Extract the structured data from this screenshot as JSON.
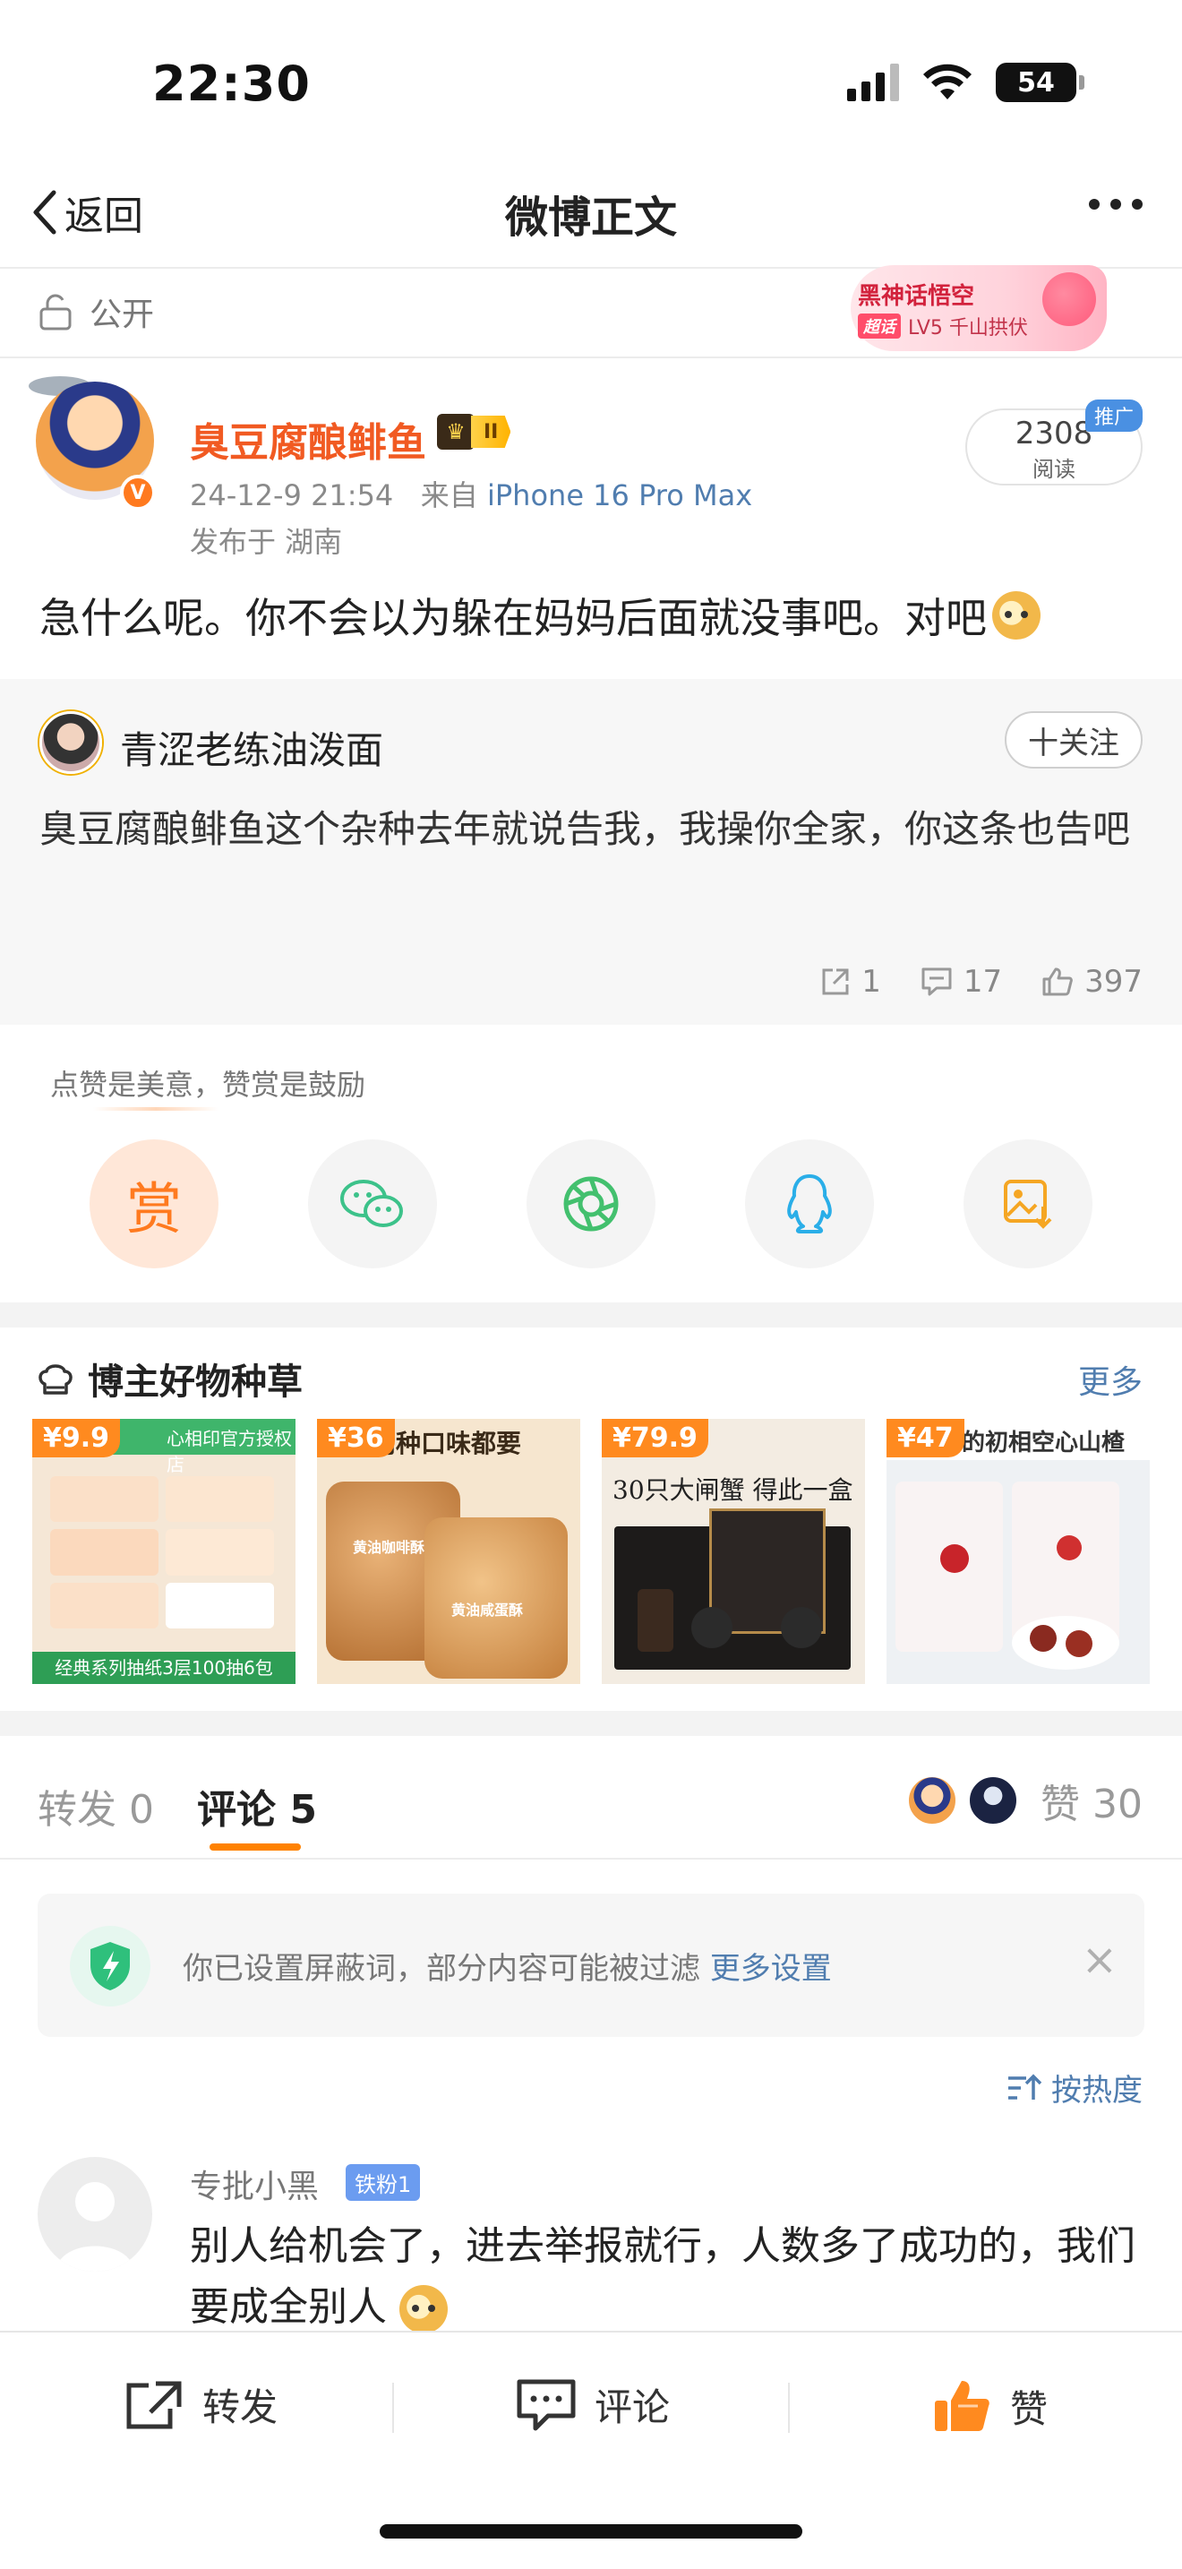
{
  "status_bar": {
    "time": "22:30",
    "battery": "54"
  },
  "nav": {
    "back_label": "返回",
    "title": "微博正文"
  },
  "visibility": {
    "label": "公开"
  },
  "promo_banner": {
    "line1": "黑神话悟空",
    "badge": "超话",
    "line2": "LV5 千山拱伏"
  },
  "author": {
    "name": "臭豆腐酿鲱鱼",
    "level_badge": "II",
    "date": "24-12-9 21:54",
    "source_prefix": "来自",
    "device": "iPhone 16 Pro Max",
    "location": "发布于 湖南",
    "verified_mark": "V"
  },
  "reads": {
    "count": "2308",
    "label": "阅读",
    "ad_tag": "推广"
  },
  "post": {
    "text": "急什么呢。你不会以为躲在妈妈后面就没事吧。对吧"
  },
  "retweet": {
    "name": "青涩老练油泼面",
    "follow_label": "十关注",
    "text": "臭豆腐酿鲱鱼这个杂种去年就说告我，我操你全家，你这条也告吧",
    "reposts": "1",
    "comments": "17",
    "likes": "397"
  },
  "tip": {
    "caption": "点赞是美意，赞赏是鼓励",
    "tip_button": "赏"
  },
  "goods": {
    "title": "博主好物种草",
    "more": "更多",
    "items": [
      {
        "price": "¥9.9",
        "caption": "经典系列抽纸3层100抽6包",
        "store": "心相印官方授权店"
      },
      {
        "price": "¥36",
        "caption": "两种口味都要",
        "tag1": "黄油咖啡酥",
        "tag2": "黄油咸蛋酥"
      },
      {
        "price": "¥79.9",
        "caption": "30只大闸蟹 得此一盒"
      },
      {
        "price": "¥47",
        "caption": "的初相空心山楂"
      }
    ]
  },
  "tabs": {
    "repost": "转发 0",
    "comment": "评论 5",
    "likes": "赞 30"
  },
  "filter": {
    "text": "你已设置屏蔽词，部分内容可能被过滤",
    "link": "更多设置"
  },
  "sort": {
    "label": "按热度"
  },
  "comment": {
    "name": "专批小黑",
    "badge": "铁粉1",
    "text": "别人给机会了，进去举报就行，人数多了成功的，我们要成全别人"
  },
  "bottom_bar": {
    "repost": "转发",
    "comment": "评论",
    "like": "赞"
  },
  "colors": {
    "accent": "#ff8200",
    "link": "#507daf",
    "author": "#f15a22"
  }
}
